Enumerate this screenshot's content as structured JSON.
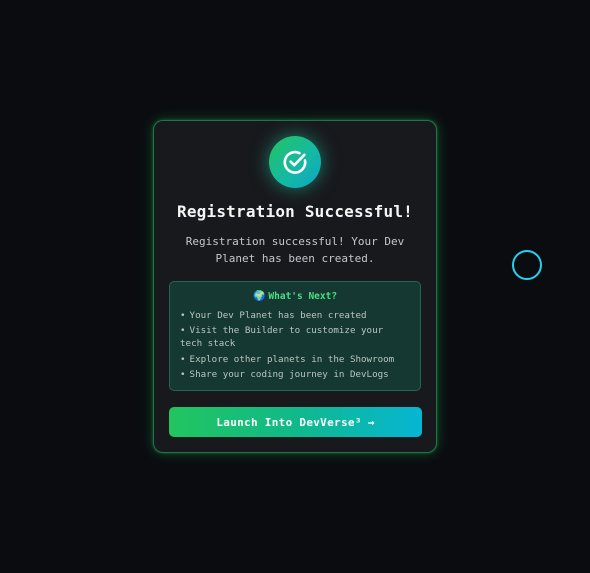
{
  "dialog": {
    "title": "Registration Successful!",
    "message": "Registration successful! Your Dev Planet has been created.",
    "next_steps": {
      "icon": "globe-icon",
      "icon_glyph": "🌍",
      "title": "What's Next?",
      "items": [
        "Your Dev Planet has been created",
        "Visit the Builder to customize your tech stack",
        "Explore other planets in the Showroom",
        "Share your coding journey in DevLogs"
      ]
    },
    "launch_button": {
      "label": "Launch Into DevVerse³",
      "arrow": "→"
    }
  },
  "colors": {
    "background": "#0b0c10",
    "card": "#18191d",
    "accent_green": "#22c55e",
    "accent_cyan": "#06b6d4",
    "next_title": "#4ade80"
  }
}
